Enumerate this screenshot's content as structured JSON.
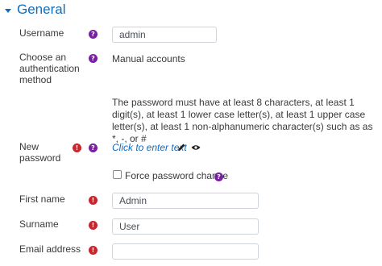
{
  "section": {
    "title": "General"
  },
  "fields": {
    "username": {
      "label": "Username",
      "value": "admin"
    },
    "auth": {
      "label": "Choose an authentication method",
      "value": "Manual accounts"
    },
    "password_policy": "The password must have at least 8 characters, at least 1 digit(s), at least 1 lower case letter(s), at least 1 upper case letter(s), at least 1 non-alphanumeric character(s) such as as *, -, or #",
    "new_password": {
      "label": "New password",
      "link_text": "Click to enter text"
    },
    "force_change": {
      "label": "Force password change",
      "checked": false
    },
    "first_name": {
      "label": "First name",
      "value": "Admin"
    },
    "surname": {
      "label": "Surname",
      "value": "User"
    },
    "email": {
      "label": "Email address",
      "value": ""
    }
  },
  "icons": {
    "help": {
      "name": "help-icon",
      "glyph": "?",
      "color": "#7a1fa2"
    },
    "required": {
      "name": "required-icon",
      "glyph": "!",
      "color": "#c9252c"
    },
    "edit": "pencil-icon",
    "reveal": "eye-icon"
  },
  "colors": {
    "accent": "#0f6cbf",
    "text": "#373a3c",
    "border": "#ced4da"
  }
}
